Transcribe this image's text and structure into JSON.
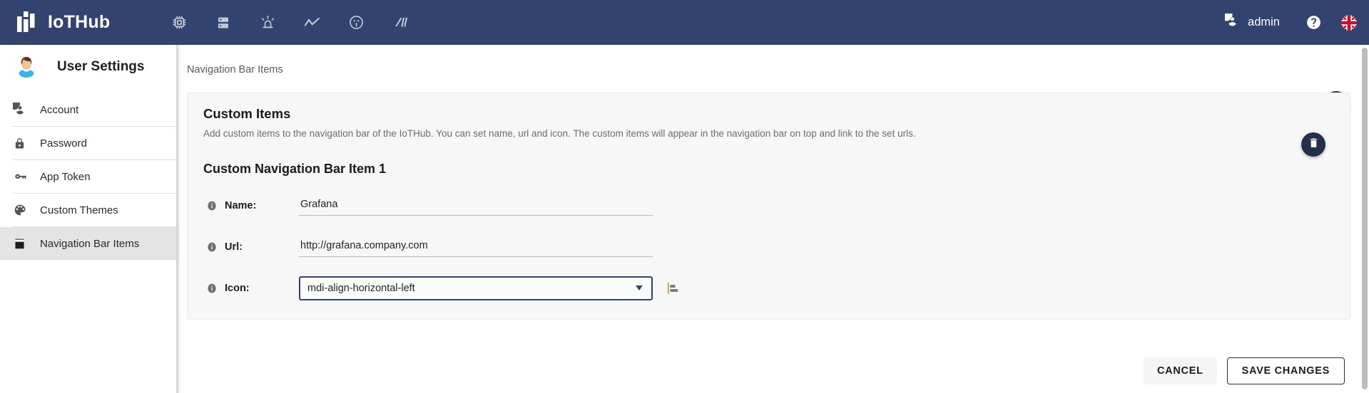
{
  "topbar": {
    "brand": "IoTHub",
    "brand_logo_icon": "iothub-bars-logo",
    "nav_icons": [
      {
        "name": "chip-icon",
        "label": "Devices"
      },
      {
        "name": "server-rack-icon",
        "label": "Assets"
      },
      {
        "name": "alarm-light-icon",
        "label": "Alarms"
      },
      {
        "name": "chart-line-icon",
        "label": "Dashboards"
      },
      {
        "name": "users-group-icon",
        "label": "Customers"
      },
      {
        "name": "rule-chain-icon",
        "label": "Rule Chains"
      }
    ],
    "account_icon": "account-circle-icon",
    "user_name": "admin",
    "help_icon": "help-circle-icon",
    "flag_icon": "uk-flag-icon",
    "background_color": "#31436e"
  },
  "sidebar": {
    "avatar_icon": "user-avatar",
    "title": "User Settings",
    "items": [
      {
        "label": "Account",
        "icon": "account-circle-icon",
        "active": false
      },
      {
        "label": "Password",
        "icon": "lock-icon",
        "active": false
      },
      {
        "label": "App Token",
        "icon": "key-icon",
        "active": false
      },
      {
        "label": "Custom Themes",
        "icon": "palette-icon",
        "active": false
      },
      {
        "label": "Navigation Bar Items",
        "icon": "book-icon",
        "active": true
      }
    ]
  },
  "main": {
    "breadcrumb": "Navigation Bar Items",
    "add_button_icon": "plus-icon",
    "card": {
      "title": "Custom Items",
      "description": "Add custom items to the navigation bar of the IoTHub. You can set name, url and icon. The custom items will appear in the navigation bar on top and link to the set urls.",
      "item_title": "Custom Navigation Bar Item 1",
      "delete_button_icon": "trash-can-icon",
      "fields": {
        "name": {
          "label": "Name:",
          "info_icon": "info-circle-icon",
          "value": "Grafana",
          "placeholder": ""
        },
        "url": {
          "label": "Url:",
          "info_icon": "info-circle-icon",
          "value": "http://grafana.company.com",
          "placeholder": ""
        },
        "icon": {
          "label": "Icon:",
          "info_icon": "info-circle-icon",
          "value": "mdi-align-horizontal-left",
          "caret_icon": "chevron-down-icon",
          "preview_icon": "align-horizontal-left-icon"
        }
      }
    }
  },
  "footer": {
    "cancel_label": "CANCEL",
    "save_label": "SAVE CHANGES"
  },
  "colors": {
    "brand_navy": "#31436e",
    "fab_navy": "#24304a",
    "active_item_bg": "#e4e4e4",
    "card_bg": "#f7f7f7"
  }
}
